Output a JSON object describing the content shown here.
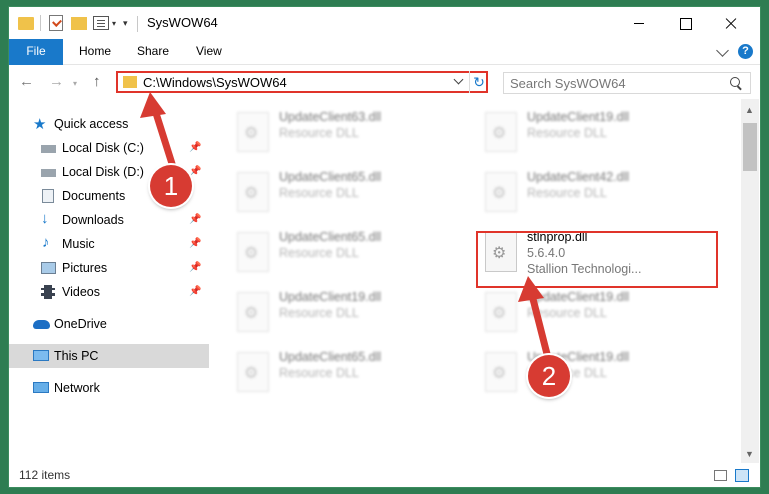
{
  "window": {
    "title": "SysWOW64"
  },
  "ribbon": {
    "tabs": [
      "File",
      "Home",
      "Share",
      "View"
    ],
    "help": "?"
  },
  "nav": {
    "address": "C:\\Windows\\SysWOW64",
    "search_placeholder": "Search SysWOW64"
  },
  "sidebar": {
    "items": [
      {
        "label": "Quick access",
        "icon": "star-icon"
      },
      {
        "label": "Local Disk (C:)",
        "icon": "drive-icon"
      },
      {
        "label": "Local Disk (D:)",
        "icon": "drive-icon"
      },
      {
        "label": "Documents",
        "icon": "documents-icon"
      },
      {
        "label": "Downloads",
        "icon": "downloads-icon"
      },
      {
        "label": "Music",
        "icon": "music-icon"
      },
      {
        "label": "Pictures",
        "icon": "pictures-icon"
      },
      {
        "label": "Videos",
        "icon": "videos-icon"
      },
      {
        "label": "OneDrive",
        "icon": "cloud-icon"
      },
      {
        "label": "This PC",
        "icon": "pc-icon"
      },
      {
        "label": "Network",
        "icon": "network-icon"
      }
    ]
  },
  "files": [
    {
      "name": "UpdateClient63.dll",
      "sub": "Resource DLL"
    },
    {
      "name": "UpdateClient19.dll",
      "sub": "Resource DLL"
    },
    {
      "name": "UpdateClient65.dll",
      "sub": "Resource DLL"
    },
    {
      "name": "UpdateClient42.dll",
      "sub": "Resource DLL"
    },
    {
      "name": "UpdateClient65.dll",
      "sub": "Resource DLL"
    },
    {
      "name": "stlnprop.dll",
      "sub": "5.6.4.0",
      "sub2": "Stallion Technologi..."
    },
    {
      "name": "UpdateClient19.dll",
      "sub": "Resource DLL"
    },
    {
      "name": "UpdateClient19.dll",
      "sub": "Resource DLL"
    },
    {
      "name": "UpdateClient65.dll",
      "sub": "Resource DLL"
    },
    {
      "name": "UpdateClient19.dll",
      "sub": "Resource DLL"
    }
  ],
  "status": {
    "items": "112 items"
  },
  "annotations": {
    "step1": "1",
    "step2": "2"
  },
  "colors": {
    "accent": "#1979ca",
    "highlight": "#e0342a",
    "background": "#2e7d52"
  }
}
